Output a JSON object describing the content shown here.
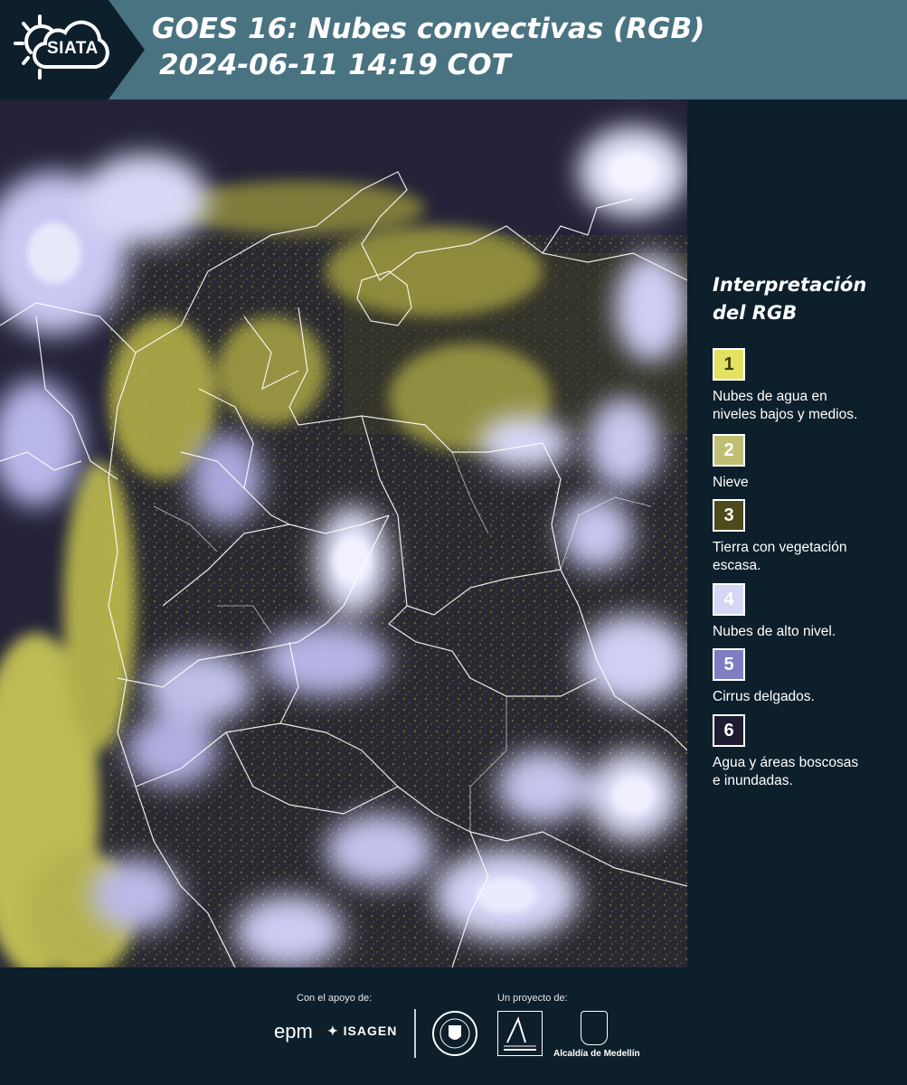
{
  "header": {
    "logo_text": "SIATA",
    "title_line1": "GOES 16: Nubes convectivas (RGB)",
    "title_line2": "2024-06-11 14:19 COT"
  },
  "legend": {
    "title_line1": "Interpretación",
    "title_line2": "del RGB",
    "items": [
      {
        "number": "1",
        "color": "#e3e062",
        "text_color": "#3a3a10",
        "description": "Nubes de agua en\nniveles bajos y medios."
      },
      {
        "number": "2",
        "color": "#bfbf74",
        "text_color": "#ffffff",
        "description": "Nieve"
      },
      {
        "number": "3",
        "color": "#4d4a1c",
        "text_color": "#ffffff",
        "description": "Tierra con vegetación\nescasa."
      },
      {
        "number": "4",
        "color": "#d6d6f5",
        "text_color": "#ffffff",
        "description": "Nubes de alto nivel."
      },
      {
        "number": "5",
        "color": "#7e7ec0",
        "text_color": "#ffffff",
        "description": "Cirrus delgados."
      },
      {
        "number": "6",
        "color": "#1f1b30",
        "text_color": "#ffffff",
        "description": "Agua y áreas boscosas\ne inundadas."
      }
    ]
  },
  "footer": {
    "support_label": "Con el apoyo de:",
    "project_label": "Un proyecto de:",
    "sponsor1": "epm",
    "sponsor2": "ISAGEN",
    "partner_alcaldia": "Alcaldía de Medellín"
  },
  "colors": {
    "background": "#0d1f2b",
    "header_band": "#4a7382",
    "low_cloud_yellow": "#e3e062",
    "high_cloud_lavender": "#d6d6f5",
    "ground_dark": "#2a2a32"
  }
}
